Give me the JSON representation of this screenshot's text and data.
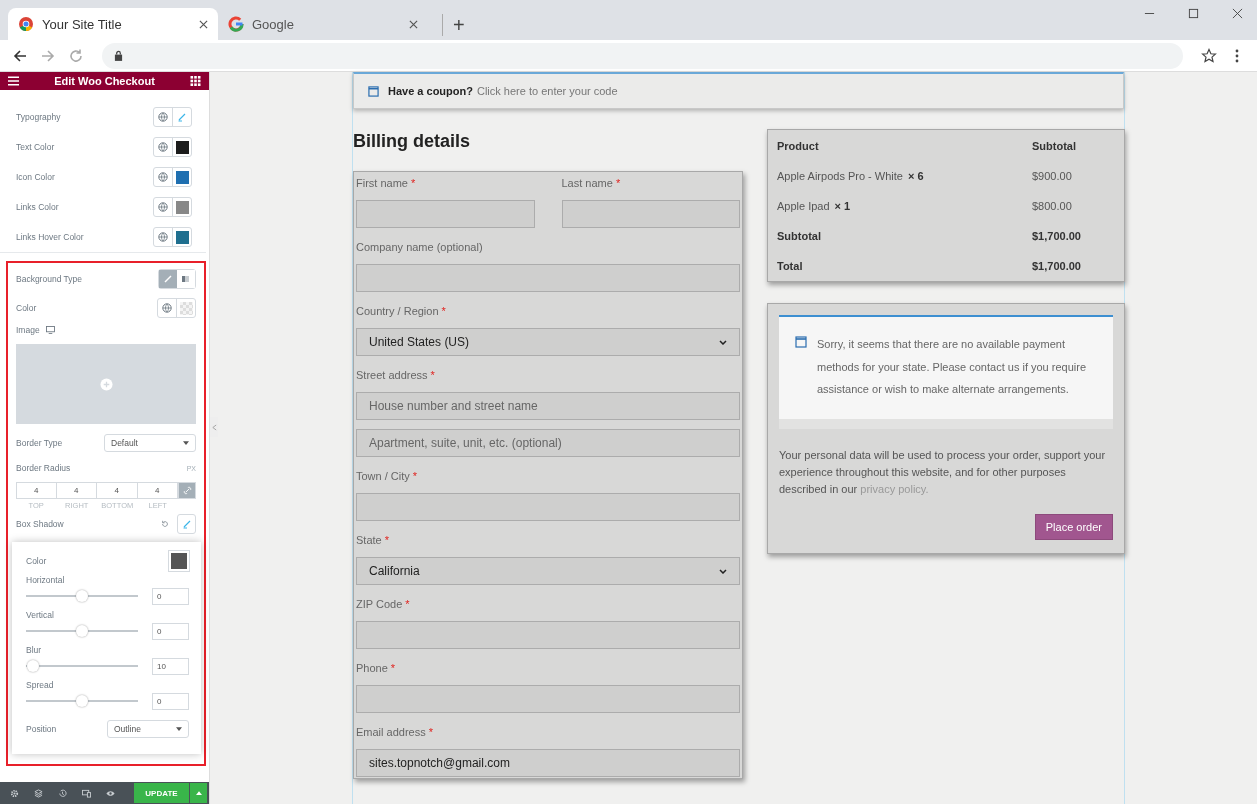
{
  "browser": {
    "tabs": [
      {
        "title": "Your Site Title",
        "selected": true
      },
      {
        "title": "Google",
        "selected": false
      }
    ],
    "new_tab": "+"
  },
  "editor": {
    "title": "Edit Woo Checkout",
    "style_rows": [
      {
        "label": "Typography",
        "kind": "edit"
      },
      {
        "label": "Text Color",
        "kind": "color",
        "color": "#1c1c1c"
      },
      {
        "label": "Icon Color",
        "kind": "color",
        "color": "#1f6fb0"
      },
      {
        "label": "Links Color",
        "kind": "color",
        "color": "#888888"
      },
      {
        "label": "Links Hover Color",
        "kind": "color",
        "color": "#1f6f8f"
      }
    ],
    "background_type": {
      "label": "Background Type",
      "options": [
        {
          "kind": "classic",
          "selected": true
        },
        {
          "kind": "gradient",
          "selected": false
        }
      ]
    },
    "color_label": "Color",
    "image_label": "Image",
    "border_type": {
      "label": "Border Type",
      "value": "Default"
    },
    "border_radius": {
      "label": "Border Radius",
      "unit": "PX",
      "linked": true,
      "sides": [
        {
          "value": "4",
          "label": "TOP"
        },
        {
          "value": "4",
          "label": "RIGHT"
        },
        {
          "value": "4",
          "label": "BOTTOM"
        },
        {
          "value": "4",
          "label": "LEFT"
        }
      ]
    },
    "box_shadow": {
      "label": "Box Shadow",
      "color_label": "Color",
      "sliders": [
        {
          "label": "Horizontal",
          "level": 0.5,
          "value": "0"
        },
        {
          "label": "Vertical",
          "level": 0.5,
          "value": "0"
        },
        {
          "label": "Blur",
          "level": 0.06,
          "value": "10"
        },
        {
          "label": "Spread",
          "level": 0.5,
          "value": "0"
        }
      ],
      "position": {
        "label": "Position",
        "value": "Outline"
      }
    },
    "update": "UPDATE"
  },
  "checkout": {
    "coupon": {
      "question": "Have a coupon?",
      "link": "Click here to enter your code"
    },
    "billing_title": "Billing details",
    "field_rows": [
      {
        "fields": [
          {
            "label": "First name",
            "required_mark": "*",
            "kind": "text"
          },
          {
            "label": "Last name",
            "required_mark": "*",
            "kind": "text"
          }
        ]
      },
      {
        "fields": [
          {
            "label": "Company name (optional)",
            "kind": "text"
          }
        ]
      },
      {
        "fields": [
          {
            "label": "Country / Region",
            "required_mark": "*",
            "kind": "select",
            "value": "United States (US)"
          }
        ]
      },
      {
        "fields": [
          {
            "label": "Street address",
            "required_mark": "*",
            "kind": "text",
            "placeholder": "House number and street name"
          }
        ]
      },
      {
        "fields": [
          {
            "kind": "text",
            "placeholder": "Apartment, suite, unit, etc. (optional)"
          }
        ]
      },
      {
        "fields": [
          {
            "label": "Town / City",
            "required_mark": "*",
            "kind": "text"
          }
        ]
      },
      {
        "fields": [
          {
            "label": "State",
            "required_mark": "*",
            "kind": "select",
            "value": "California"
          }
        ]
      },
      {
        "fields": [
          {
            "label": "ZIP Code",
            "required_mark": "*",
            "kind": "text"
          }
        ]
      },
      {
        "fields": [
          {
            "label": "Phone",
            "required_mark": "*",
            "kind": "text"
          }
        ]
      },
      {
        "fields": [
          {
            "label": "Email address",
            "required_mark": "*",
            "kind": "text",
            "value": "sites.topnotch@gmail.com"
          }
        ]
      }
    ],
    "order": {
      "columns": [
        "Product",
        "Subtotal"
      ],
      "rows": [
        {
          "kind": "item",
          "product": "Apple Airpods Pro - White",
          "qty": "× 6",
          "amount": "$900.00"
        },
        {
          "kind": "item",
          "product": "Apple Ipad",
          "qty": "× 1",
          "amount": "$800.00"
        },
        {
          "kind": "total",
          "product": "Subtotal",
          "amount": "$1,700.00"
        },
        {
          "kind": "total",
          "product": "Total",
          "amount": "$1,700.00"
        }
      ]
    },
    "payment_notice": "Sorry, it seems that there are no available payment methods for your state. Please contact us if you require assistance or wish to make alternate arrangements.",
    "privacy": {
      "text": "Your personal data will be used to process your order, support your experience throughout this website, and for other purposes described in our",
      "link": "privacy policy."
    },
    "place_order": "Place order"
  }
}
